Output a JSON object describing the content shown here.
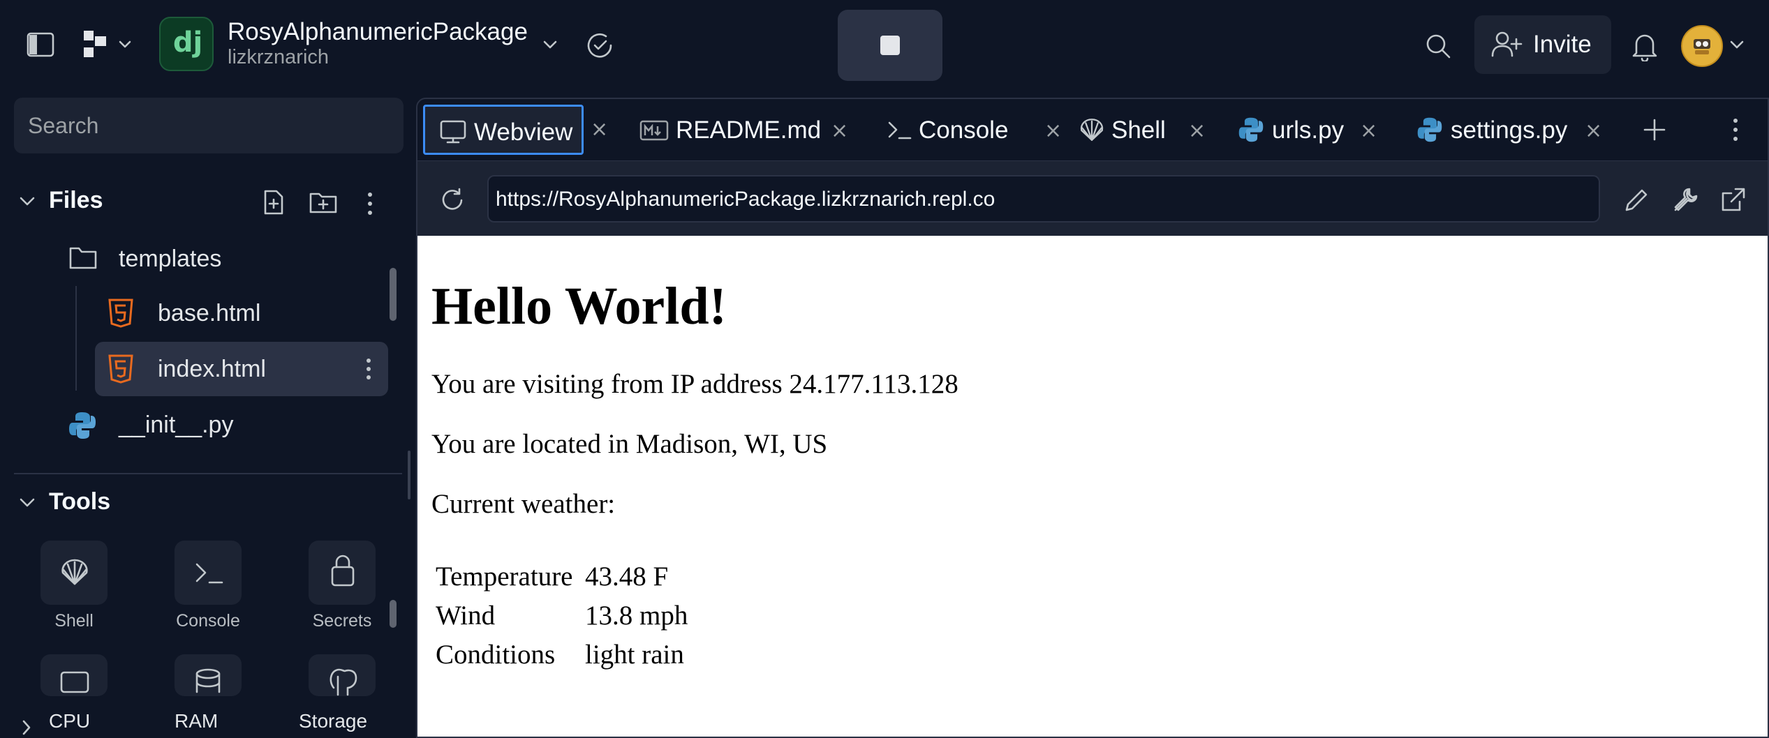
{
  "topbar": {
    "repl_name": "RosyAlphanumericPackage",
    "repl_owner": "lizkrznarich",
    "repl_logo_text": "dj",
    "invite_label": "Invite"
  },
  "sidebar": {
    "search_placeholder": "Search",
    "files_title": "Files",
    "files": [
      {
        "label": "templates",
        "icon": "folder-icon"
      },
      {
        "label": "base.html",
        "icon": "html5-icon"
      },
      {
        "label": "index.html",
        "icon": "html5-icon",
        "selected": true
      },
      {
        "label": "__init__.py",
        "icon": "python-icon"
      }
    ],
    "tools_title": "Tools",
    "tools": [
      {
        "label": "Shell",
        "icon": "shell-icon"
      },
      {
        "label": "Console",
        "icon": "console-icon"
      },
      {
        "label": "Secrets",
        "icon": "lock-icon"
      }
    ],
    "resources": [
      "CPU",
      "RAM",
      "Storage"
    ]
  },
  "tabs": [
    {
      "label": "Webview",
      "icon": "monitor-icon",
      "active": true
    },
    {
      "label": "README.md",
      "icon": "markdown-icon"
    },
    {
      "label": "Console",
      "icon": "console-icon"
    },
    {
      "label": "Shell",
      "icon": "shell-icon"
    },
    {
      "label": "urls.py",
      "icon": "python-icon"
    },
    {
      "label": "settings.py",
      "icon": "python-icon"
    }
  ],
  "webview": {
    "url": "https://RosyAlphanumericPackage.lizkrznarich.repl.co"
  },
  "page": {
    "heading": "Hello World!",
    "ip_line": "You are visiting from IP address 24.177.113.128",
    "location_line": "You are located in Madison, WI, US",
    "weather_label": "Current weather:",
    "weather": [
      {
        "key": "Temperature",
        "value": "43.48 F"
      },
      {
        "key": "Wind",
        "value": "13.8 mph"
      },
      {
        "key": "Conditions",
        "value": "light rain"
      }
    ]
  },
  "colors": {
    "background": "#0e1525",
    "surface": "#1c2333",
    "accent": "#3c8cf8",
    "html_icon": "#e86a1f",
    "python_icon": "#3d8fc6"
  }
}
